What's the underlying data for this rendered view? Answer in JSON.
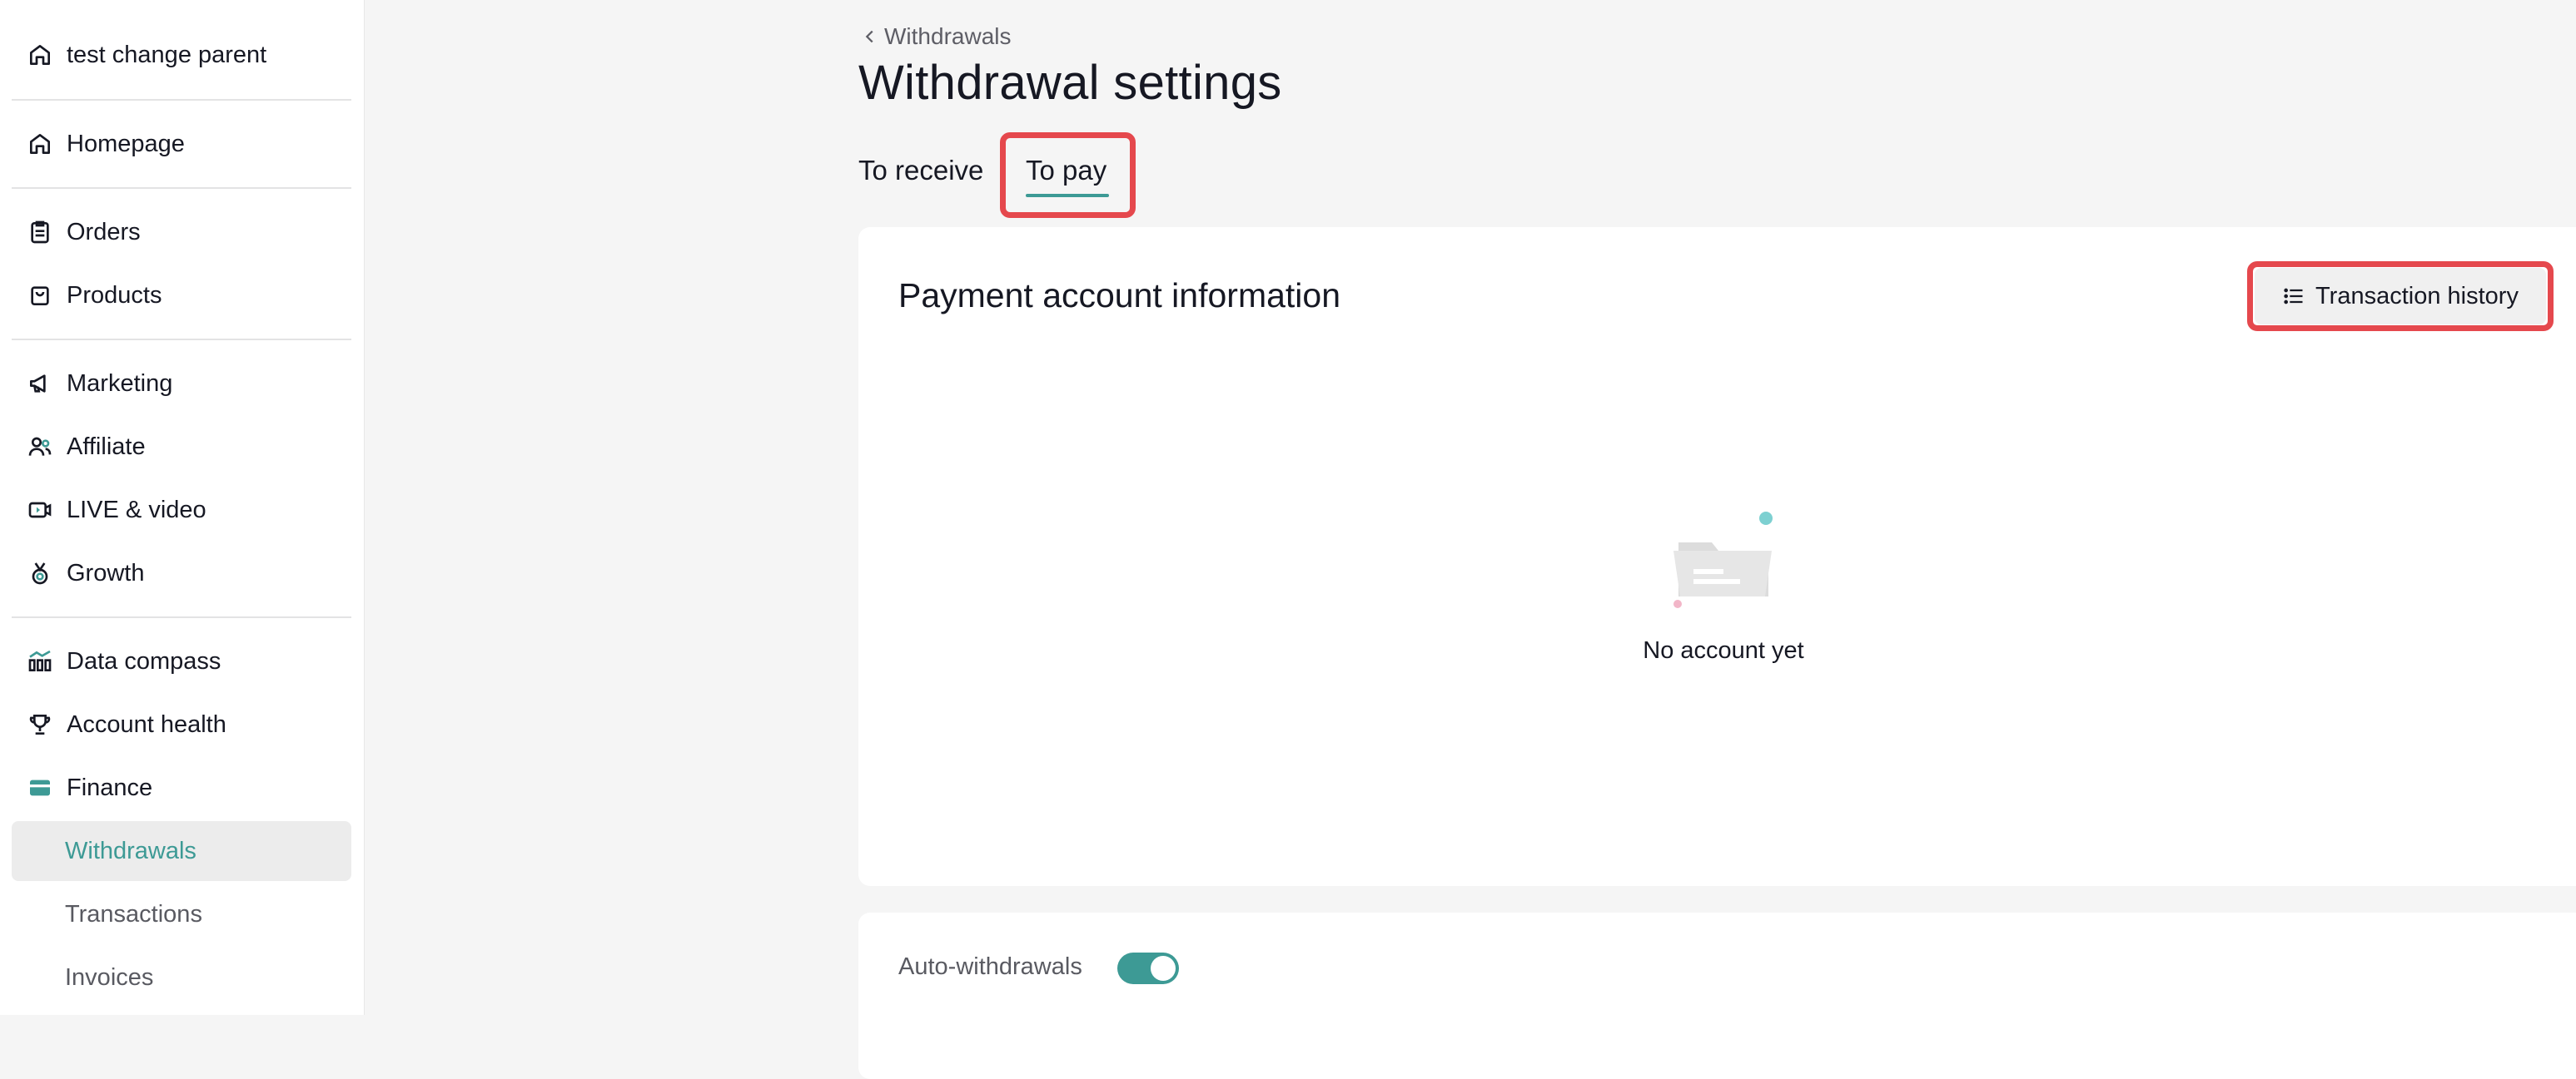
{
  "shop": {
    "name": "test change parent",
    "icon": "home-icon"
  },
  "sidebar": {
    "items": [
      {
        "label": "Homepage",
        "icon": "home-icon"
      },
      {
        "label": "Orders",
        "icon": "clipboard-icon"
      },
      {
        "label": "Products",
        "icon": "shopping-bag-icon"
      },
      {
        "label": "Marketing",
        "icon": "megaphone-icon"
      },
      {
        "label": "Affiliate",
        "icon": "users-icon"
      },
      {
        "label": "LIVE & video",
        "icon": "video-icon"
      },
      {
        "label": "Growth",
        "icon": "medal-icon"
      },
      {
        "label": "Data compass",
        "icon": "bar-chart-icon"
      },
      {
        "label": "Account health",
        "icon": "trophy-icon"
      },
      {
        "label": "Finance",
        "icon": "wallet-icon"
      }
    ],
    "finance_sub": [
      {
        "label": "Withdrawals",
        "active": true
      },
      {
        "label": "Transactions",
        "active": false
      },
      {
        "label": "Invoices",
        "active": false
      }
    ]
  },
  "breadcrumb": {
    "back_label": "Withdrawals"
  },
  "page": {
    "title": "Withdrawal settings"
  },
  "tabs": [
    {
      "label": "To receive",
      "active": false
    },
    {
      "label": "To pay",
      "active": true
    }
  ],
  "payment_card": {
    "title": "Payment account information",
    "history_button": "Transaction history",
    "empty_text": "No account yet"
  },
  "auto_withdrawals": {
    "label": "Auto-withdrawals",
    "enabled": true
  },
  "colors": {
    "accent": "#3d9a95",
    "highlight": "#e5484d",
    "background": "#f5f5f5"
  }
}
